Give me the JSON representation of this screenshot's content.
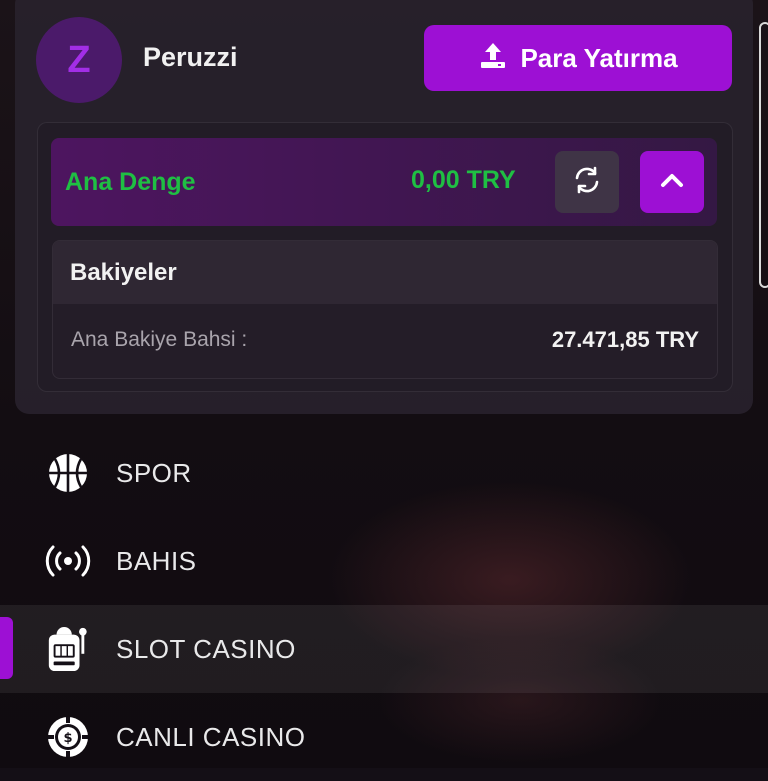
{
  "user": {
    "avatar_letter": "Z",
    "name": "Peruzzi"
  },
  "header": {
    "deposit_label": "Para Yatırma"
  },
  "balance": {
    "label": "Ana Denge",
    "amount": "0,00 TRY"
  },
  "balances_panel": {
    "title": "Bakiyeler",
    "row_label": "Ana Bakiye Bahsi :",
    "row_value": "27.471,85 TRY"
  },
  "nav": {
    "items": [
      {
        "label": "SPOR",
        "icon": "basketball-icon"
      },
      {
        "label": "BAHIS",
        "icon": "broadcast-icon"
      },
      {
        "label": "SLOT CASINO",
        "icon": "slot-machine-icon",
        "active": true
      },
      {
        "label": "CANLI CASINO",
        "icon": "casino-chip-icon"
      }
    ]
  },
  "colors": {
    "accent": "#9d10d4",
    "balance_green": "#1fbf43",
    "panel": "#28212c"
  }
}
